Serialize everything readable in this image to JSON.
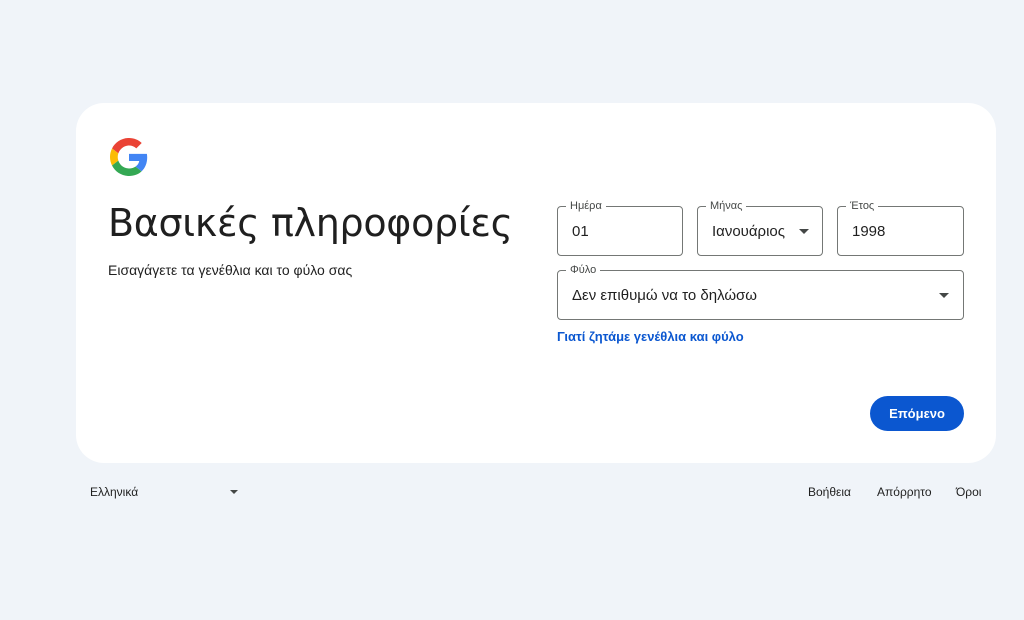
{
  "header": {
    "logo_icon": "google-g-logo",
    "title": "Βασικές πληροφορίες",
    "subtitle": "Εισαγάγετε τα γενέθλια και το φύλο σας"
  },
  "birthday": {
    "day": {
      "label": "Ημέρα",
      "value": "01"
    },
    "month": {
      "label": "Μήνας",
      "value": "Ιανουάριος"
    },
    "year": {
      "label": "Έτος",
      "value": "1998"
    }
  },
  "gender": {
    "label": "Φύλο",
    "value": "Δεν επιθυμώ να το δηλώσω"
  },
  "why_link": "Γιατί ζητάμε γενέθλια και φύλο",
  "next_button": "Επόμενο",
  "footer": {
    "language": "Ελληνικά",
    "help": "Βοήθεια",
    "privacy": "Απόρρητο",
    "terms": "Όροι"
  },
  "colors": {
    "background": "#f0f4f9",
    "card": "#ffffff",
    "accent": "#0b57d0",
    "field_border": "#747775"
  }
}
